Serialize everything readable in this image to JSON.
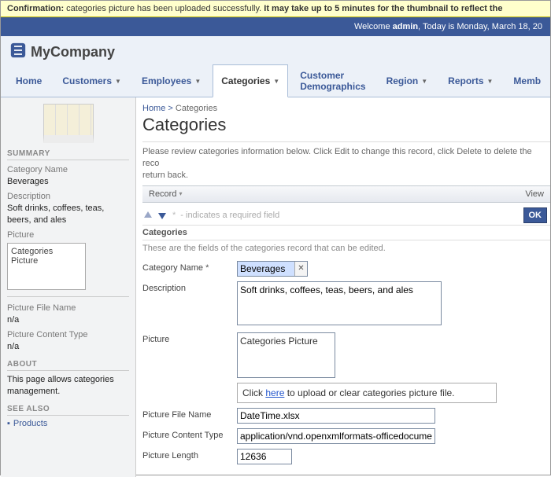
{
  "confirmation": {
    "prefix": "Confirmation:",
    "body": " categories picture has been uploaded successfully. ",
    "em": "It may take up to 5 minutes for the thumbnail to reflect the"
  },
  "welcome": {
    "pre": "Welcome ",
    "user": "admin",
    "post": ", Today is Monday, March 18, 20"
  },
  "brand": "MyCompany",
  "tabs": {
    "home": "Home",
    "customers": "Customers",
    "employees": "Employees",
    "categories": "Categories",
    "custdemo": "Customer Demographics",
    "region": "Region",
    "reports": "Reports",
    "members": "Memb"
  },
  "sidebar": {
    "summaryTitle": "SUMMARY",
    "catNameLabel": "Category Name",
    "catNameValue": "Beverages",
    "descLabel": "Description",
    "descValue": "Soft drinks, coffees, teas, beers, and ales",
    "picLabel": "Picture",
    "picValue": "Categories Picture",
    "pfnLabel": "Picture File Name",
    "pfnValue": "n/a",
    "pctLabel": "Picture Content Type",
    "pctValue": "n/a",
    "aboutTitle": "ABOUT",
    "aboutText": "This page allows categories management.",
    "seeAlsoTitle": "SEE ALSO",
    "seeAlsoItem": "Products"
  },
  "main": {
    "bcHome": "Home",
    "bcSep": " > ",
    "bcCurrent": "Categories",
    "title": "Categories",
    "info": "Please review categories information below. Click Edit to change this record, click Delete to delete the reco\nreturn back.",
    "recordLabel": "Record",
    "viewLabel": "View",
    "reqHint": " - indicates a required field",
    "okLabel": "OK",
    "sectionHeader": "Categories",
    "sectionDesc": "These are the fields of the categories record that can be edited.",
    "fields": {
      "catNameLabel": "Category Name",
      "catNameVal": "Beverages",
      "descLabel": "Description",
      "descVal": "Soft drinks, coffees, teas, beers, and ales",
      "picLabel": "Picture",
      "picVal": "Categories Picture",
      "uploadPre": "Click ",
      "uploadLink": "here",
      "uploadPost": " to upload or clear categories picture file.",
      "pfnLabel": "Picture File Name",
      "pfnVal": "DateTime.xlsx",
      "pctLabel": "Picture Content Type",
      "pctVal": "application/vnd.openxmlformats-officedocument.sprea",
      "plLabel": "Picture Length",
      "plVal": "12636"
    }
  }
}
